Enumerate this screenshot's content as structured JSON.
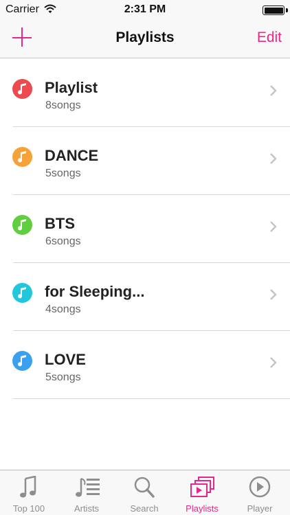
{
  "status_bar": {
    "carrier": "Carrier",
    "time": "2:31 PM"
  },
  "nav": {
    "title": "Playlists",
    "edit_label": "Edit",
    "accent_color": "#e6268d"
  },
  "playlists": [
    {
      "name": "Playlist",
      "count": "8songs",
      "color": "#ec4a4f"
    },
    {
      "name": "DANCE",
      "count": "5songs",
      "color": "#f6a23a"
    },
    {
      "name": "BTS",
      "count": "6songs",
      "color": "#5fce3f"
    },
    {
      "name": "for Sleeping...",
      "count": "4songs",
      "color": "#21c8dc"
    },
    {
      "name": "LOVE",
      "count": "5songs",
      "color": "#3aa0f0"
    }
  ],
  "tabs": [
    {
      "label": "Top 100",
      "icon": "music-note-icon",
      "active": false
    },
    {
      "label": "Artists",
      "icon": "artists-list-icon",
      "active": false
    },
    {
      "label": "Search",
      "icon": "search-icon",
      "active": false
    },
    {
      "label": "Playlists",
      "icon": "playlists-icon",
      "active": true
    },
    {
      "label": "Player",
      "icon": "play-circle-icon",
      "active": false
    }
  ]
}
